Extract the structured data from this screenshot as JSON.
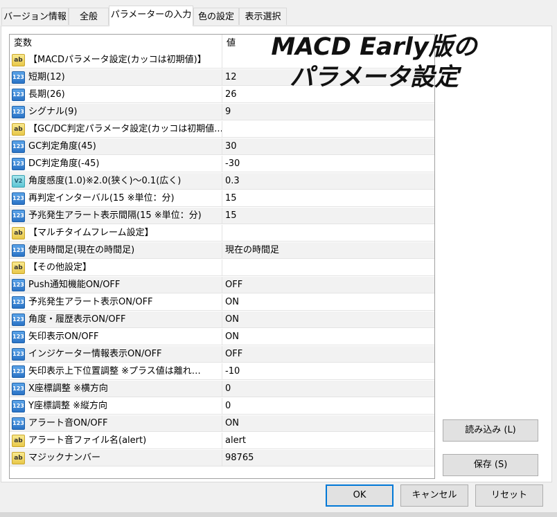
{
  "tabs": [
    "バージョン情報",
    "全般",
    "パラメーターの入力",
    "色の設定",
    "表示選択"
  ],
  "overlay": {
    "line1": "MACD Early版の",
    "line2": "パラメータ設定"
  },
  "grid": {
    "headers": {
      "variable": "変数",
      "value": "値"
    },
    "rows": [
      {
        "icon": "ab",
        "label": "【MACDパラメータ設定(カッコは初期値)】",
        "value": ""
      },
      {
        "icon": "123",
        "label": "短期(12)",
        "value": "12"
      },
      {
        "icon": "123",
        "label": "長期(26)",
        "value": "26"
      },
      {
        "icon": "123",
        "label": "シグナル(9)",
        "value": "9"
      },
      {
        "icon": "ab",
        "label": "【GC/DC判定パラメータ設定(カッコは初期値...",
        "value": ""
      },
      {
        "icon": "123",
        "label": "GC判定角度(45)",
        "value": "30"
      },
      {
        "icon": "123",
        "label": "DC判定角度(-45)",
        "value": "-30"
      },
      {
        "icon": "v2",
        "label": "角度感度(1.0)※2.0(狭く)～0.1(広く)",
        "value": "0.3"
      },
      {
        "icon": "123",
        "label": "再判定インターバル(15 ※単位：分)",
        "value": "15"
      },
      {
        "icon": "123",
        "label": "予兆発生アラート表示間隔(15 ※単位：分)",
        "value": "15"
      },
      {
        "icon": "ab",
        "label": "【マルチタイムフレーム設定】",
        "value": ""
      },
      {
        "icon": "123",
        "label": "使用時間足(現在の時間足)",
        "value": "現在の時間足"
      },
      {
        "icon": "ab",
        "label": "【その他設定】",
        "value": ""
      },
      {
        "icon": "123",
        "label": "Push通知機能ON/OFF",
        "value": "OFF"
      },
      {
        "icon": "123",
        "label": "予兆発生アラート表示ON/OFF",
        "value": "ON"
      },
      {
        "icon": "123",
        "label": "角度・履歴表示ON/OFF",
        "value": "ON"
      },
      {
        "icon": "123",
        "label": "矢印表示ON/OFF",
        "value": "ON"
      },
      {
        "icon": "123",
        "label": "インジケーター情報表示ON/OFF",
        "value": "OFF"
      },
      {
        "icon": "123",
        "label": "矢印表示上下位置調整 ※プラス値は離れ…",
        "value": "-10"
      },
      {
        "icon": "123",
        "label": "X座標調整 ※横方向",
        "value": "0"
      },
      {
        "icon": "123",
        "label": "Y座標調整 ※縦方向",
        "value": "0"
      },
      {
        "icon": "123",
        "label": "アラート音ON/OFF",
        "value": "ON"
      },
      {
        "icon": "ab",
        "label": "アラート音ファイル名(alert)",
        "value": "alert"
      },
      {
        "icon": "ab",
        "label": "マジックナンバー",
        "value": "98765"
      }
    ]
  },
  "buttons": {
    "load": "読み込み (L)",
    "save": "保存 (S)",
    "ok": "OK",
    "cancel": "キャンセル",
    "reset": "リセット"
  }
}
